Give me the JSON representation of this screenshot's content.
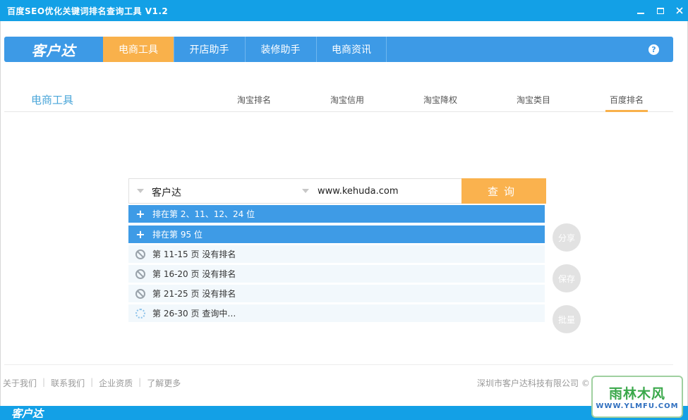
{
  "window": {
    "title": "百度SEO优化关键词排名查询工具 V1.2"
  },
  "topnav": {
    "logo": "客户达",
    "tabs": [
      {
        "label": "电商工具",
        "active": true
      },
      {
        "label": "开店助手"
      },
      {
        "label": "装修助手"
      },
      {
        "label": "电商资讯"
      }
    ],
    "help": "?"
  },
  "subheader": {
    "section_title": "电商工具",
    "tabs": [
      {
        "label": "淘宝排名"
      },
      {
        "label": "淘宝信用"
      },
      {
        "label": "淘宝降权"
      },
      {
        "label": "淘宝类目"
      },
      {
        "label": "百度排名",
        "active": true
      }
    ]
  },
  "query": {
    "keyword": "客户达",
    "site": "www.kehuda.com",
    "button_label": "查询"
  },
  "results": [
    {
      "type": "expand",
      "text": "排在第 2、11、12、24 位"
    },
    {
      "type": "expand",
      "text": "排在第 95 位"
    },
    {
      "type": "none",
      "text": "第 11-15 页 没有排名"
    },
    {
      "type": "none",
      "text": "第 16-20 页 没有排名"
    },
    {
      "type": "none",
      "text": "第 21-25 页 没有排名"
    },
    {
      "type": "loading",
      "text": "第 26-30 页 查询中…"
    }
  ],
  "side_buttons": {
    "share": "分享",
    "save": "保存",
    "batch": "批量"
  },
  "footer": {
    "links": [
      "关于我们",
      "联系我们",
      "企业资质",
      "了解更多"
    ],
    "company": "深圳市客户达科技有限公司 ©"
  },
  "bottombar": {
    "logo": "客户达"
  },
  "watermark": {
    "line1": "雨林木风",
    "line2": "WWW.YLMFU.COM"
  },
  "colors": {
    "titlebar": "#13a0e6",
    "nav": "#3d9ae6",
    "accent": "#f9b14b",
    "row_blue": "#3e9be6",
    "row_grey": "#f2f8fc"
  }
}
